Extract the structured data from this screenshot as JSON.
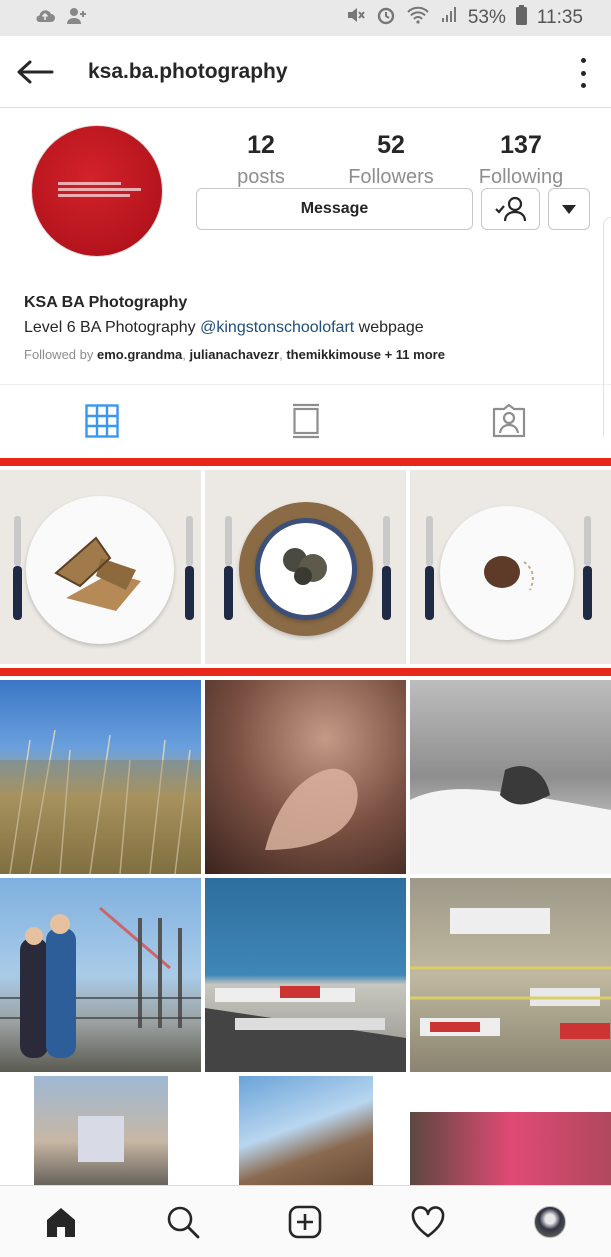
{
  "status_bar": {
    "battery": "53%",
    "time": "11:35"
  },
  "header": {
    "username": "ksa.ba.photography"
  },
  "profile": {
    "stats": [
      {
        "value": "12",
        "label": "posts"
      },
      {
        "value": "52",
        "label": "Followers"
      },
      {
        "value": "137",
        "label": "Following"
      }
    ],
    "message_label": "Message",
    "name": "KSA BA Photography",
    "bio_prefix": "Level 6 BA Photography ",
    "bio_mention": "@kingstonschoolofart",
    "bio_suffix": " webpage",
    "followed_by_prefix": "Followed by ",
    "followed_by_users": [
      "emo.grandma",
      "julianachavezr",
      "themikkimouse"
    ],
    "followed_by_more": "+ 11 more"
  },
  "colors": {
    "accent_blue": "#3897f0",
    "mention_blue": "#1e4e79",
    "highlight_red": "#e8281b",
    "avatar_red": "#c41a23"
  },
  "tabs": [
    "grid-icon",
    "feed-icon",
    "tagged-icon"
  ],
  "bottom_nav": [
    "home-icon",
    "search-icon",
    "add-post-icon",
    "activity-icon",
    "profile-avatar"
  ]
}
